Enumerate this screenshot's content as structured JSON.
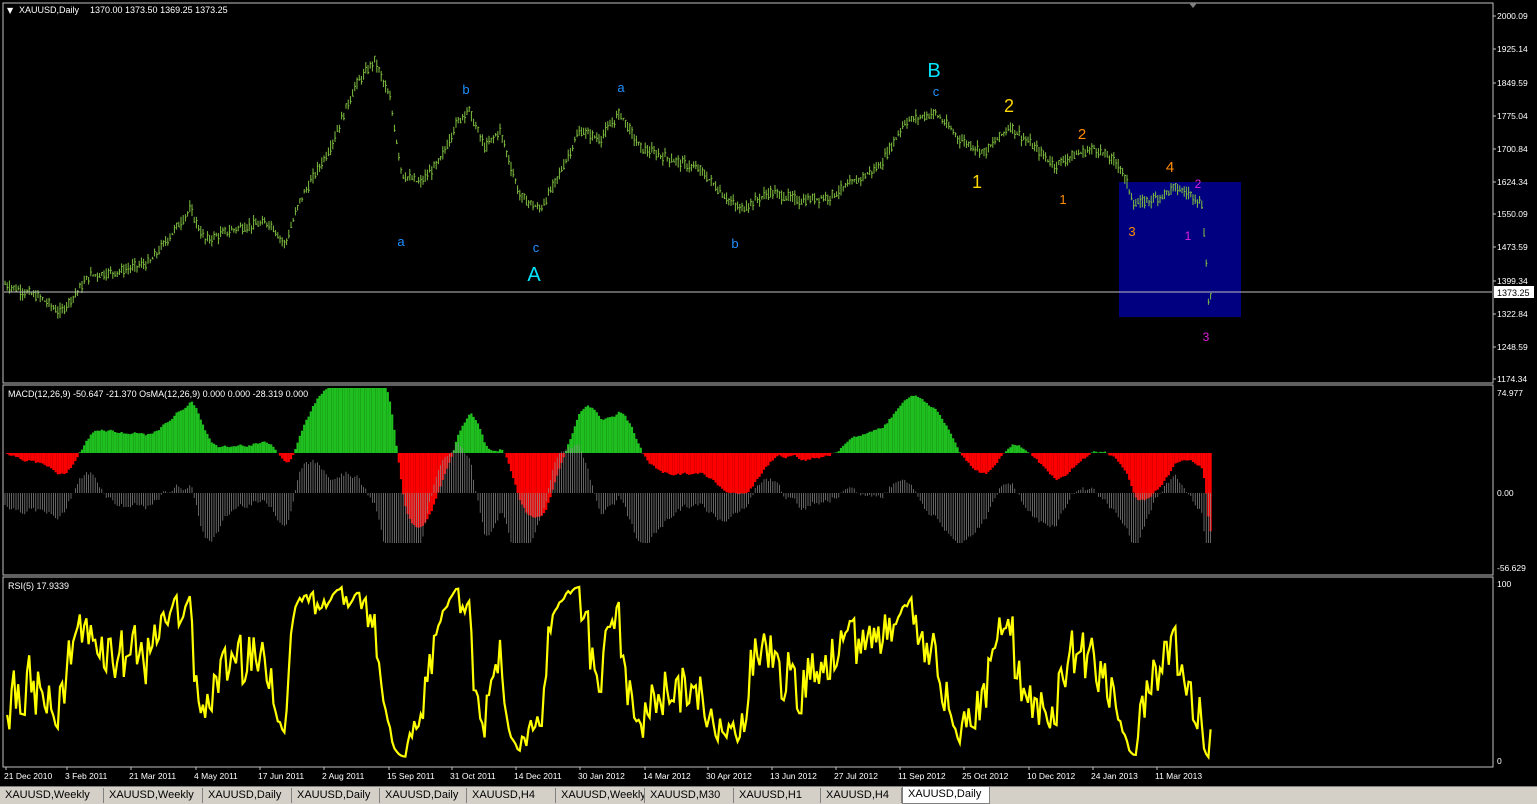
{
  "title": "XAUUSD,Daily",
  "ohlc": "1370.00 1373.50 1369.25 1373.25",
  "current_price": "1373.25",
  "price_axis": [
    "2000.09",
    "1925.14",
    "1849.59",
    "1775.04",
    "1700.84",
    "1624.34",
    "1550.09",
    "1473.59",
    "1399.34",
    "1322.84",
    "1248.59",
    "1174.34"
  ],
  "macd_label": "MACD(12,26,9) -50.647 -21.370  OsMA(12,26,9) 0.000 0.000 -28.319 0.000",
  "macd_axis": [
    "74.977",
    "0.00",
    "-56.629"
  ],
  "rsi_label": "RSI(5) 17.9339",
  "rsi_axis": [
    "100",
    "0"
  ],
  "time_axis": [
    "21 Dec 2010",
    "3 Feb 2011",
    "21 Mar 2011",
    "4 May 2011",
    "17 Jun 2011",
    "2 Aug 2011",
    "15 Sep 2011",
    "31 Oct 2011",
    "14 Dec 2011",
    "30 Jan 2012",
    "14 Mar 2012",
    "30 Apr 2012",
    "13 Jun 2012",
    "27 Jul 2012",
    "11 Sep 2012",
    "25 Oct 2012",
    "10 Dec 2012",
    "24 Jan 2013",
    "11 Mar 2013"
  ],
  "wave_labels": [
    {
      "text": "a",
      "color": "#1e90ff"
    },
    {
      "text": "b",
      "color": "#1e90ff"
    },
    {
      "text": "c",
      "color": "#1e90ff"
    },
    {
      "text": "A",
      "color": "#00e5ff"
    },
    {
      "text": "a",
      "color": "#1e90ff"
    },
    {
      "text": "b",
      "color": "#1e90ff"
    },
    {
      "text": "B",
      "color": "#00e5ff"
    },
    {
      "text": "c",
      "color": "#1e90ff"
    },
    {
      "text": "1",
      "color": "#ffd700"
    },
    {
      "text": "2",
      "color": "#ffd700"
    },
    {
      "text": "1",
      "color": "#ff8c00"
    },
    {
      "text": "2",
      "color": "#ff8c00"
    },
    {
      "text": "3",
      "color": "#ff8c00"
    },
    {
      "text": "4",
      "color": "#ff8c00"
    },
    {
      "text": "1",
      "color": "#e020e0"
    },
    {
      "text": "2",
      "color": "#e020e0"
    },
    {
      "text": "3",
      "color": "#e020e0"
    }
  ],
  "tabs": [
    {
      "label": "XAUUSD,Weekly",
      "active": false
    },
    {
      "label": "XAUUSD,Weekly",
      "active": false
    },
    {
      "label": "XAUUSD,Daily",
      "active": false
    },
    {
      "label": "XAUUSD,Daily",
      "active": false
    },
    {
      "label": "XAUUSD,Daily",
      "active": false
    },
    {
      "label": "XAUUSD,H4",
      "active": false
    },
    {
      "label": "XAUUSD,Weekly",
      "active": false
    },
    {
      "label": "XAUUSD,M30",
      "active": false
    },
    {
      "label": "XAUUSD,H1",
      "active": false
    },
    {
      "label": "XAUUSD,H4",
      "active": false
    },
    {
      "label": "XAUUSD,Daily",
      "active": true
    }
  ],
  "colors": {
    "bars": "#7fbf3f",
    "macd_up": "#1fbf1f",
    "macd_down": "#ff0000",
    "osma": "#909090",
    "rsi": "#ffff00",
    "grid": "#c0c0c0",
    "box": "#000080"
  },
  "chart_data": [
    {
      "type": "candlestick",
      "title": "XAUUSD,Daily",
      "ylim": [
        1174.34,
        2000.09
      ],
      "price_path": [
        [
          "21 Dec 2010",
          1390
        ],
        [
          "3 Feb 2011",
          1330
        ],
        [
          "21 Mar 2011",
          1420
        ],
        [
          "4 May 2011",
          1510
        ],
        [
          "17 Jun 2011",
          1540
        ],
        [
          "2 Aug 2011",
          1650
        ],
        [
          "15 Sep 2011",
          1870
        ],
        [
          "15 Sep 2011",
          1620
        ],
        [
          "31 Oct 2011",
          1780
        ],
        [
          "14 Dec 2011",
          1560
        ],
        [
          "30 Jan 2012",
          1740
        ],
        [
          "14 Mar 2012",
          1680
        ],
        [
          "30 Apr 2012",
          1640
        ],
        [
          "13 Jun 2012",
          1600
        ],
        [
          "27 Jul 2012",
          1610
        ],
        [
          "11 Sep 2012",
          1780
        ],
        [
          "25 Oct 2012",
          1700
        ],
        [
          "10 Dec 2012",
          1680
        ],
        [
          "24 Jan 2013",
          1600
        ],
        [
          "11 Mar 2013",
          1600
        ],
        [
          "11 Mar 2013",
          1373.25
        ]
      ]
    },
    {
      "type": "bar",
      "title": "MACD(12,26,9) -50.647 -21.370  OsMA(12,26,9) 0.000 0.000 -28.319 0.000",
      "ylim": [
        -56.629,
        74.977
      ],
      "macd_last": -50.647,
      "signal_last": -21.37
    },
    {
      "type": "line",
      "title": "RSI(5) 17.9339",
      "ylim": [
        0,
        100
      ],
      "last": 17.9339
    }
  ]
}
